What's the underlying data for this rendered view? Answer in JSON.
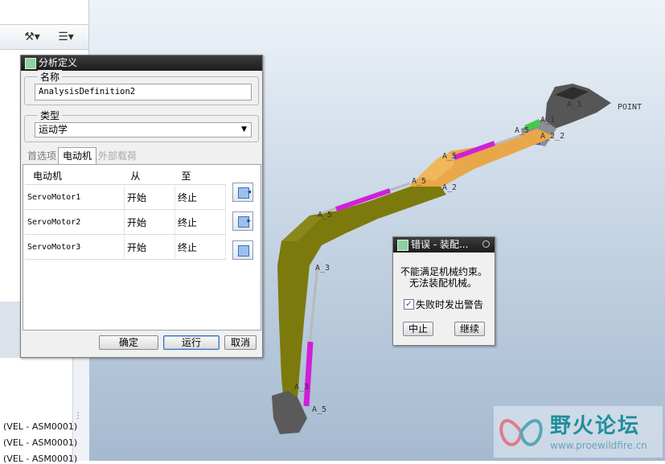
{
  "model_tree": {
    "rows": [
      "(VEL - ASM0001)",
      "(VEL - ASM0001)",
      "(VEL - ASM0001)"
    ],
    "toolbar_icons": [
      "tools-icon",
      "list-icon"
    ]
  },
  "viewport": {
    "labels": {
      "a3_top": "A_3",
      "point": "POINT",
      "a1": "A_1",
      "a2_2": "A_2_2",
      "a5_1": "A_5",
      "a5_2": "A_5",
      "a5_3": "A_5",
      "a5_4": "A_5",
      "a2_mid": "A_2",
      "a3_mid": "A_3",
      "a5_left": "A_5",
      "a3_low": "A_3",
      "a5_bottom": "A_5"
    },
    "colors": {
      "boom": "#7c7a0c",
      "stick": "#e8a84a",
      "cylinder": "#d020d8",
      "bucket": "#555555"
    }
  },
  "analysis_dialog": {
    "title": "分析定义",
    "name_group_label": "名称",
    "name_value": "AnalysisDefinition2",
    "type_group_label": "类型",
    "type_value": "运动学",
    "tabs": [
      "首选项",
      "电动机",
      "外部载荷"
    ],
    "table": {
      "headers": [
        "电动机",
        "从",
        "至"
      ],
      "rows": [
        {
          "motor": "ServoMotor1",
          "from": "开始",
          "to": "终止"
        },
        {
          "motor": "ServoMotor2",
          "from": "开始",
          "to": "终止"
        },
        {
          "motor": "ServoMotor3",
          "from": "开始",
          "to": "终止"
        }
      ]
    },
    "buttons": {
      "ok": "确定",
      "run": "运行",
      "cancel": "取消"
    }
  },
  "error_dialog": {
    "title": "错误 - 装配...",
    "message_line1": "不能满足机械约束。",
    "message_line2": "无法装配机械。",
    "checkbox_label": "失败时发出警告",
    "checkbox_checked": true,
    "buttons": {
      "abort": "中止",
      "continue": "继续"
    }
  },
  "watermark": {
    "title": "野火论坛",
    "url": "www.proewildfire.cn"
  }
}
